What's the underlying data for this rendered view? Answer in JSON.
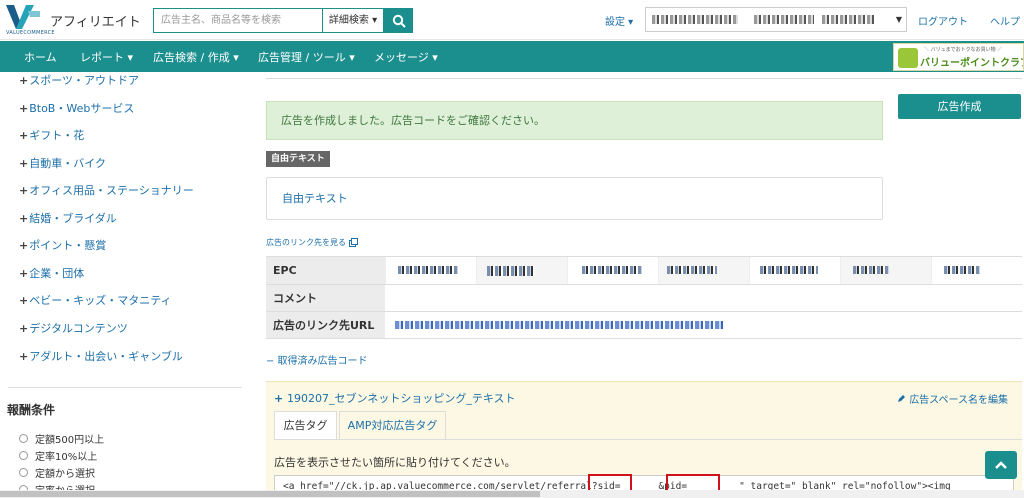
{
  "header": {
    "app_title": "アフィリエイト",
    "logo_sub": "VALUECOMMERCE",
    "search_placeholder": "広告主名、商品名等を検索",
    "advanced_search_label": "詳細検索 ▾",
    "settings_label": "設定 ▾",
    "logout_label": "ログアウト",
    "help_label": "ヘルプ"
  },
  "nav": {
    "items": [
      "ホーム",
      "レポート ▾",
      "広告検索 / 作成 ▾",
      "広告管理 / ツール ▾",
      "メッセージ ▾"
    ],
    "banner_small": "＼ バリュまでおトクなお買い物 ／",
    "banner_main": "バリューポイントクラブ"
  },
  "sidebar": {
    "categories": [
      "スポーツ・アウトドア",
      "BtoB・Webサービス",
      "ギフト・花",
      "自動車・バイク",
      "オフィス用品・ステーショナリー",
      "結婚・ブライダル",
      "ポイント・懸賞",
      "企業・団体",
      "ベビー・キッズ・マタニティ",
      "デジタルコンテンツ",
      "アダルト・出会い・ギャンブル"
    ],
    "reward_title": "報酬条件",
    "reward_options": [
      "定額500円以上",
      "定率10%以上",
      "定額から選択",
      "定率から選択"
    ]
  },
  "main": {
    "success_message": "広告を作成しました。広告コードをご確認ください。",
    "create_button": "広告作成",
    "free_text_tag": "自由テキスト",
    "free_text_link": "自由テキスト",
    "link_preview": "広告のリンク先を見る",
    "table": {
      "epc_label": "EPC",
      "comment_label": "コメント",
      "link_label": "広告のリンク先URL"
    },
    "acquired_code_label": "− 取得済み広告コード",
    "campaign_name": "190207_セブンネットショッピング_テキスト",
    "edit_space_label": "広告スペース名を編集",
    "tabs": [
      "広告タグ",
      "AMP対応広告タグ"
    ],
    "paste_instruction": "広告を表示させたい箇所に貼り付けてください。",
    "code_part1": "<a href=\"//ck.jp.ap.valuecommerce.com/servlet/referral?sid=",
    "code_part2": "&pid=",
    "code_part3": "\" target=\"_blank\" rel=\"nofollow\"><img"
  },
  "colors": {
    "accent": "#1b8e8e",
    "link": "#1b6fa8",
    "alert_bg": "#dff0d8",
    "panel_bg": "#fcf8e3",
    "highlight_red": "#d0121b"
  }
}
